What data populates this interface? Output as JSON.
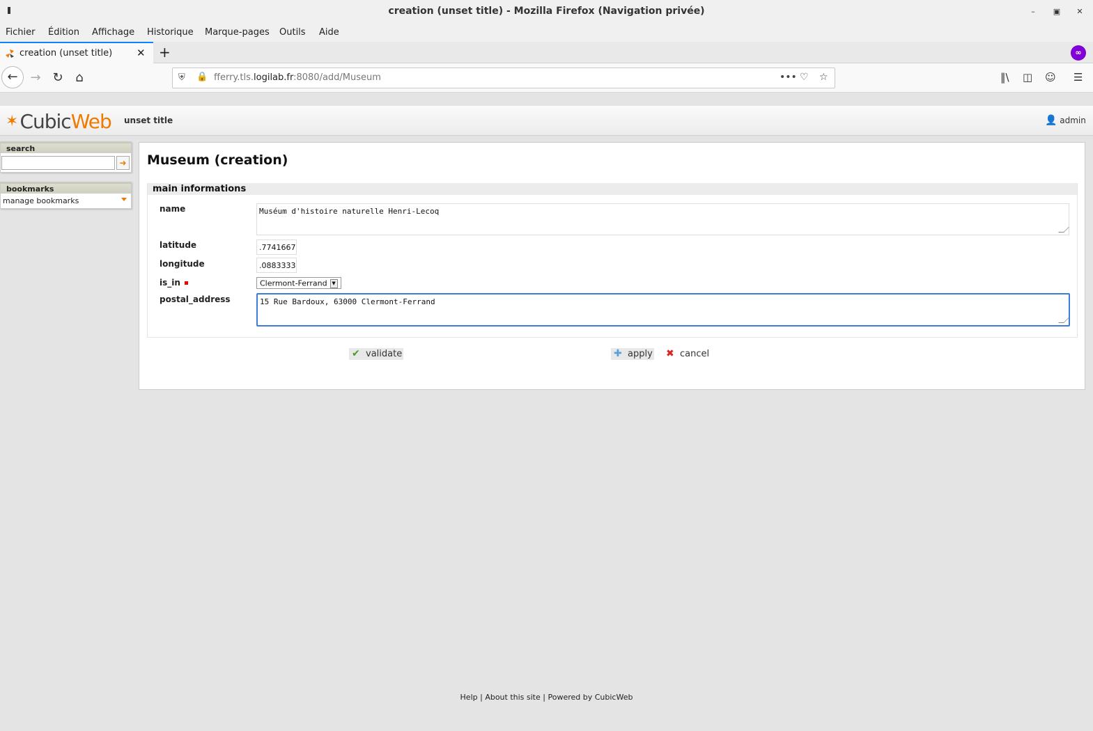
{
  "window": {
    "title": "creation (unset title) - Mozilla Firefox (Navigation privée)",
    "minimize_icon": "minimize-icon",
    "maximize_icon": "maximize-icon",
    "close_icon": "close-icon"
  },
  "menubar": {
    "items": [
      "Fichier",
      "Édition",
      "Affichage",
      "Historique",
      "Marque-pages",
      "Outils",
      "Aide"
    ]
  },
  "tabs": {
    "active_tab": "creation (unset title)"
  },
  "navbar": {
    "url_prefix": "fferry.tls.",
    "url_domain": "logilab.fr",
    "url_suffix": ":8080/add/Museum"
  },
  "app": {
    "logo_cubic": "Cubic",
    "logo_web": "Web",
    "site_title": "unset title",
    "user": "admin"
  },
  "sidebar": {
    "search_title": "search",
    "bookmarks_title": "bookmarks",
    "bookmarks_select": "manage bookmarks"
  },
  "form": {
    "heading": "Museum (creation)",
    "section": "main informations",
    "fields": {
      "name_label": "name",
      "name_value": "Muséum d'histoire naturelle Henri-Lecoq",
      "latitude_label": "latitude",
      "latitude_value": ".7741667",
      "longitude_label": "longitude",
      "longitude_value": ".0883333",
      "is_in_label": "is_in",
      "is_in_value": "Clermont-Ferrand",
      "postal_address_label": "postal_address",
      "postal_address_value": "15 Rue Bardoux, 63000 Clermont-Ferrand"
    },
    "buttons": {
      "validate": "validate",
      "apply": "apply",
      "cancel": "cancel"
    }
  },
  "footer": {
    "help": "Help",
    "sep1": " | ",
    "about": "About this site",
    "sep2": " | ",
    "powered": "Powered by CubicWeb"
  }
}
